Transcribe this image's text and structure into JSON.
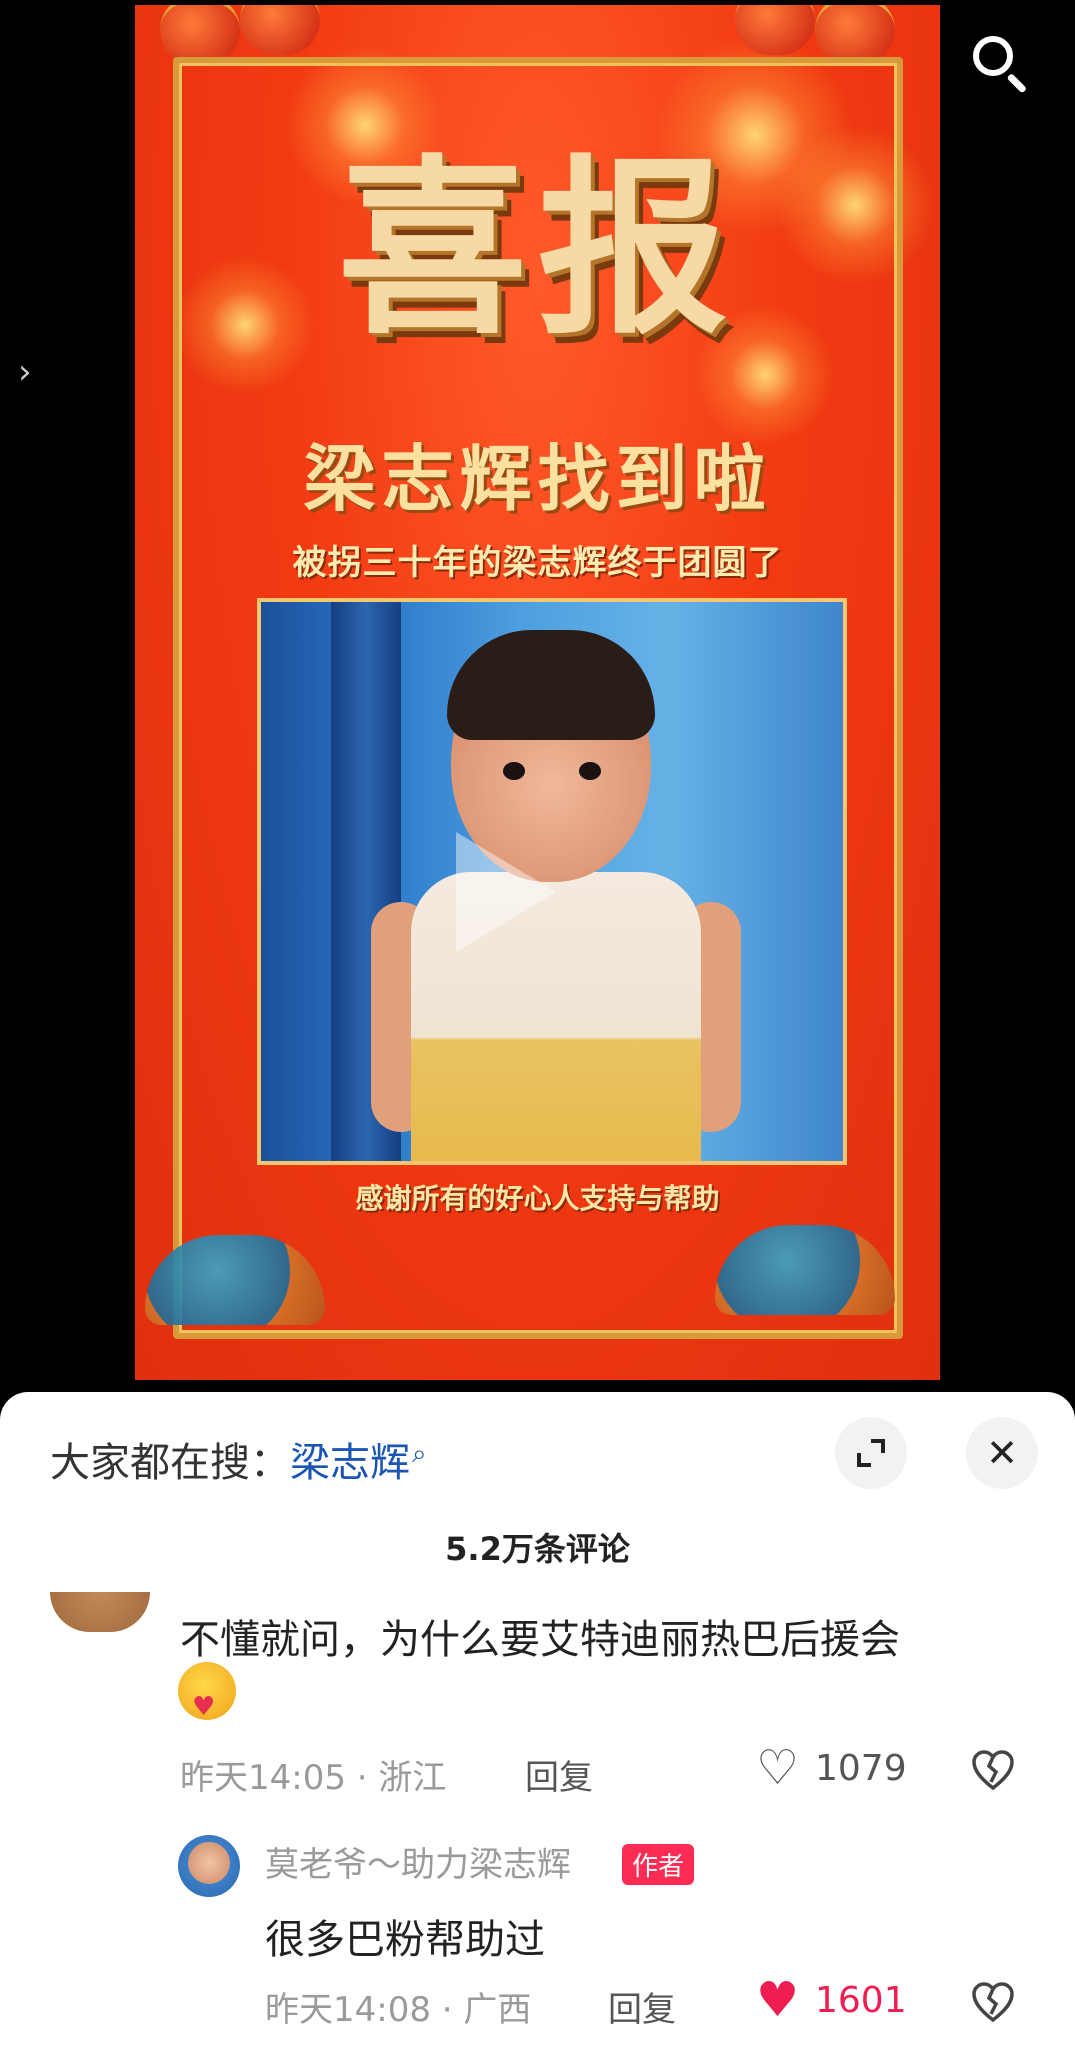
{
  "video": {
    "poster_title": "喜报",
    "poster_subtitle": "梁志辉找到啦",
    "poster_tagline": "被拐三十年的梁志辉终于团圆了",
    "poster_thanks": "感谢所有的好心人支持与帮助",
    "search_icon": "search-icon",
    "side_arrow": "›"
  },
  "sheet": {
    "hot_search_label": "大家都在搜：",
    "hot_search_keyword": "梁志辉",
    "hot_search_icon": "⌕",
    "close_icon": "✕",
    "comment_count": "5.2万条评论"
  },
  "comments": [
    {
      "text": "不懂就问，为什么要艾特迪丽热巴后援会",
      "emoji": "hug-emoji",
      "time": "昨天14:05",
      "location": "浙江",
      "reply_label": "回复",
      "likes": "1079",
      "liked": false,
      "reply": {
        "name": "莫老爷～助力梁志辉",
        "badge": "作者",
        "text": "很多巴粉帮助过",
        "time": "昨天14:08",
        "location": "广西",
        "reply_label": "回复",
        "likes": "1601",
        "liked": true
      }
    }
  ],
  "colors": {
    "accent_red": "#fe2c55",
    "keyword_blue": "#1b56b5",
    "liked_heart": "#ee1d52"
  }
}
